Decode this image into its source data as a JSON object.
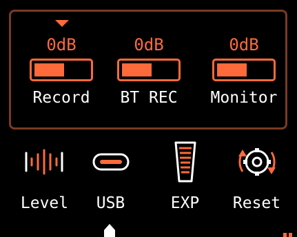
{
  "colors": {
    "accent": "#ff6a3a",
    "frame_border": "#7a3a22",
    "background": "#000000",
    "text": "#ffffff"
  },
  "mixer": {
    "selected_channel": "Record",
    "channels": [
      {
        "db": "0dB",
        "name": "Record",
        "level": 0.55
      },
      {
        "db": "0dB",
        "name": "BT REC",
        "level": 0.55
      },
      {
        "db": "0dB",
        "name": "Monitor",
        "level": 0.55
      }
    ]
  },
  "menu": {
    "selected": "USB",
    "items": [
      {
        "label": "Level",
        "icon": "level-meter-icon"
      },
      {
        "label": "USB",
        "icon": "usb-c-port-icon"
      },
      {
        "label": "EXP",
        "icon": "expression-pedal-icon"
      },
      {
        "label": "Reset",
        "icon": "reset-gear-icon"
      }
    ]
  }
}
